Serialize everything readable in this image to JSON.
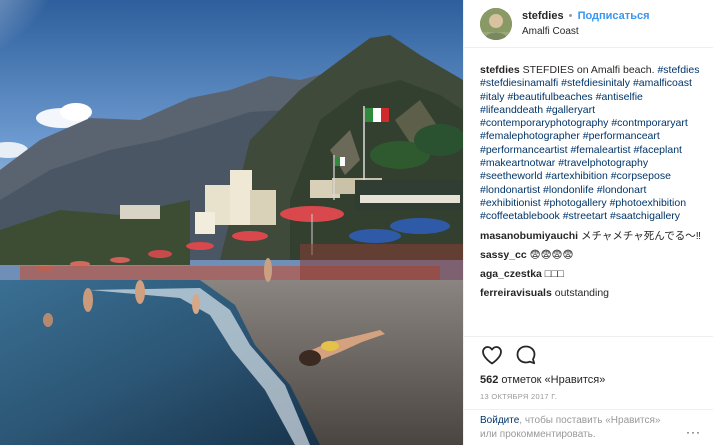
{
  "post": {
    "username": "stefdies",
    "separator": "•",
    "follow_label": "Подписаться",
    "location": "Amalfi Coast",
    "avatar_icon": "avatar-photo",
    "caption": {
      "user": "stefdies",
      "text": "STEFDIES on Amalfi beach.",
      "hashtags": [
        "#stefdies",
        "#stefdiesinamalfi",
        "#stefdiesinitaly",
        "#amalficoast",
        "#italy",
        "#beautifulbeaches",
        "#antiselfie",
        "#lifeanddeath",
        "#galleryart",
        "#contemporaryphotography",
        "#contmporaryart",
        "#femalephotographer",
        "#performanceart",
        "#performanceartist",
        "#femaleartist",
        "#faceplant",
        "#makeartnotwar",
        "#travelphotography",
        "#seetheworld",
        "#artexhibition",
        "#corpsepose",
        "#londonartist",
        "#londonlife",
        "#londonart",
        "#exhibitionist",
        "#photogallery",
        "#photoexhibition",
        "#coffeetablebook",
        "#streetart",
        "#saatchigallery"
      ]
    },
    "comments": [
      {
        "user": "masanobumiyauchi",
        "text": "メチャメチャ死んでる〜‼︎"
      },
      {
        "user": "sassy_cc",
        "text": "😨😨😨😨"
      },
      {
        "user": "aga_czestka",
        "text": "□□□"
      },
      {
        "user": "ferreiravisuals",
        "text": "outstanding"
      }
    ],
    "actions": {
      "like_icon": "heart-icon",
      "comment_icon": "comment-icon"
    },
    "likes": {
      "count": "562",
      "text": "отметок «Нравится»"
    },
    "date": "13 октября 2017 г.",
    "footer": {
      "login_link": "Войдите",
      "login_text": ", чтобы поставить «Нравится»",
      "comment_text": "или прокомментировать.",
      "more_label": "···"
    }
  },
  "colors": {
    "link": "#3897f0",
    "hashtag": "#003569",
    "muted": "#999999",
    "text": "#262626"
  }
}
